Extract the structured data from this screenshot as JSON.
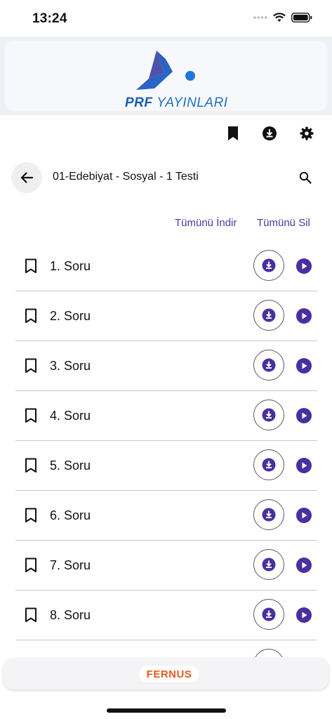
{
  "status": {
    "time": "13:24"
  },
  "brand": {
    "name_bold": "PRF",
    "name_rest": "YAYINLARI"
  },
  "page": {
    "title": "01-Edebiyat - Sosyal - 1 Testi"
  },
  "actions": {
    "download_all": "Tümünü İndir",
    "delete_all": "Tümünü Sil"
  },
  "questions": [
    {
      "label": "1. Soru"
    },
    {
      "label": "2. Soru"
    },
    {
      "label": "3. Soru"
    },
    {
      "label": "4. Soru"
    },
    {
      "label": "5. Soru"
    },
    {
      "label": "6. Soru"
    },
    {
      "label": "7. Soru"
    },
    {
      "label": "8. Soru"
    },
    {
      "label": ""
    }
  ],
  "footer": {
    "brand": "FERNUS"
  },
  "colors": {
    "accent": "#4a2fa0",
    "link": "#4a3aa6",
    "brand_blue": "#1f6fbf",
    "footer_orange": "#e75a1e"
  },
  "icons": [
    "bookmark-icon",
    "download-icon",
    "settings-icon",
    "back-arrow-icon",
    "search-icon",
    "play-icon"
  ]
}
